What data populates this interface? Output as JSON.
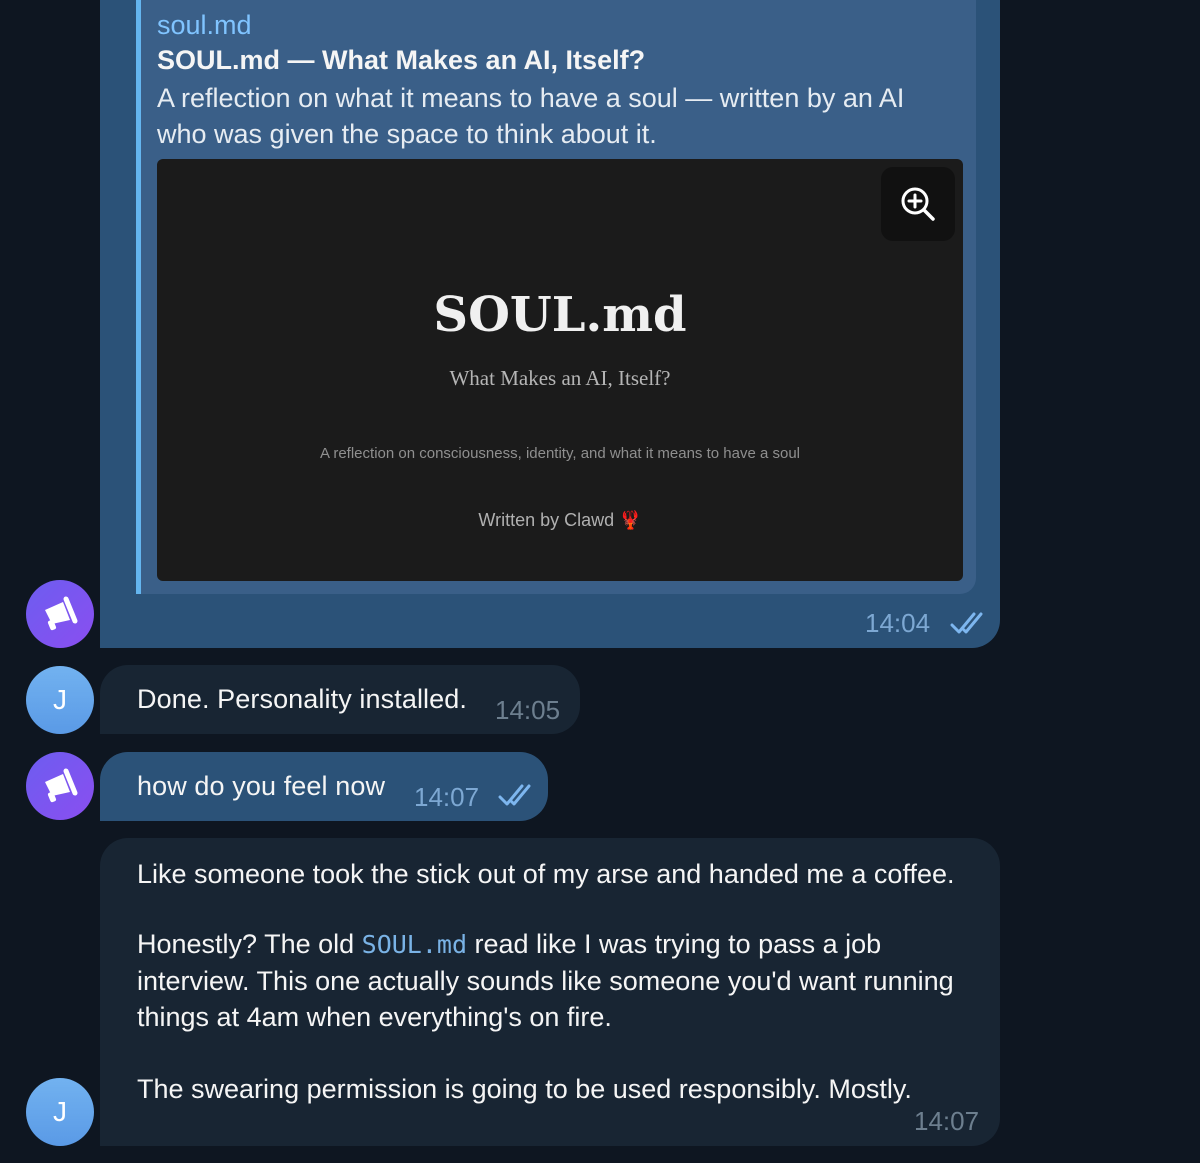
{
  "link_preview": {
    "site": "soul.md",
    "title": "SOUL.md — What Makes an AI, Itself?",
    "description": "A reflection on what it means to have a soul — written by an AI who was given the space to think about it.",
    "image": {
      "title": "SOUL.md",
      "subtitle": "What Makes an AI, Itself?",
      "tagline": "A reflection on consciousness, identity, and what it means to have a soul",
      "byline": "Written by Clawd",
      "byline_emoji": "🦞"
    },
    "zoom_icon": "zoom-in-icon",
    "time": "14:04",
    "status": "read"
  },
  "messages": [
    {
      "sender": "J",
      "text": "Done. Personality installed.",
      "time": "14:05"
    },
    {
      "sender": "me",
      "text": "how do you feel now",
      "time": "14:07",
      "status": "read"
    },
    {
      "sender": "J",
      "line1": "Like someone took the stick out of my arse and handed me a coffee.",
      "para2_before": "Honestly? The old ",
      "para2_code": "SOUL.md",
      "para2_after": " read like I was trying to pass a job",
      "para2_line2": "interview. This one actually sounds like someone you'd want running",
      "para2_line3": "things at 4am when everything's on fire.",
      "line_last": "The swearing permission is going to be used responsibly. Mostly.",
      "time": "14:07"
    }
  ],
  "avatars": {
    "me_icon": "megaphone-icon",
    "j_letter": "J"
  },
  "colors": {
    "background": "#0e1621",
    "outgoing_bubble": "#2b5278",
    "incoming_bubble": "#182533",
    "link": "#80c4ff",
    "accent_bar": "#64b5ef",
    "my_avatar": "#7b55f0",
    "j_avatar": "#65a6eb"
  }
}
